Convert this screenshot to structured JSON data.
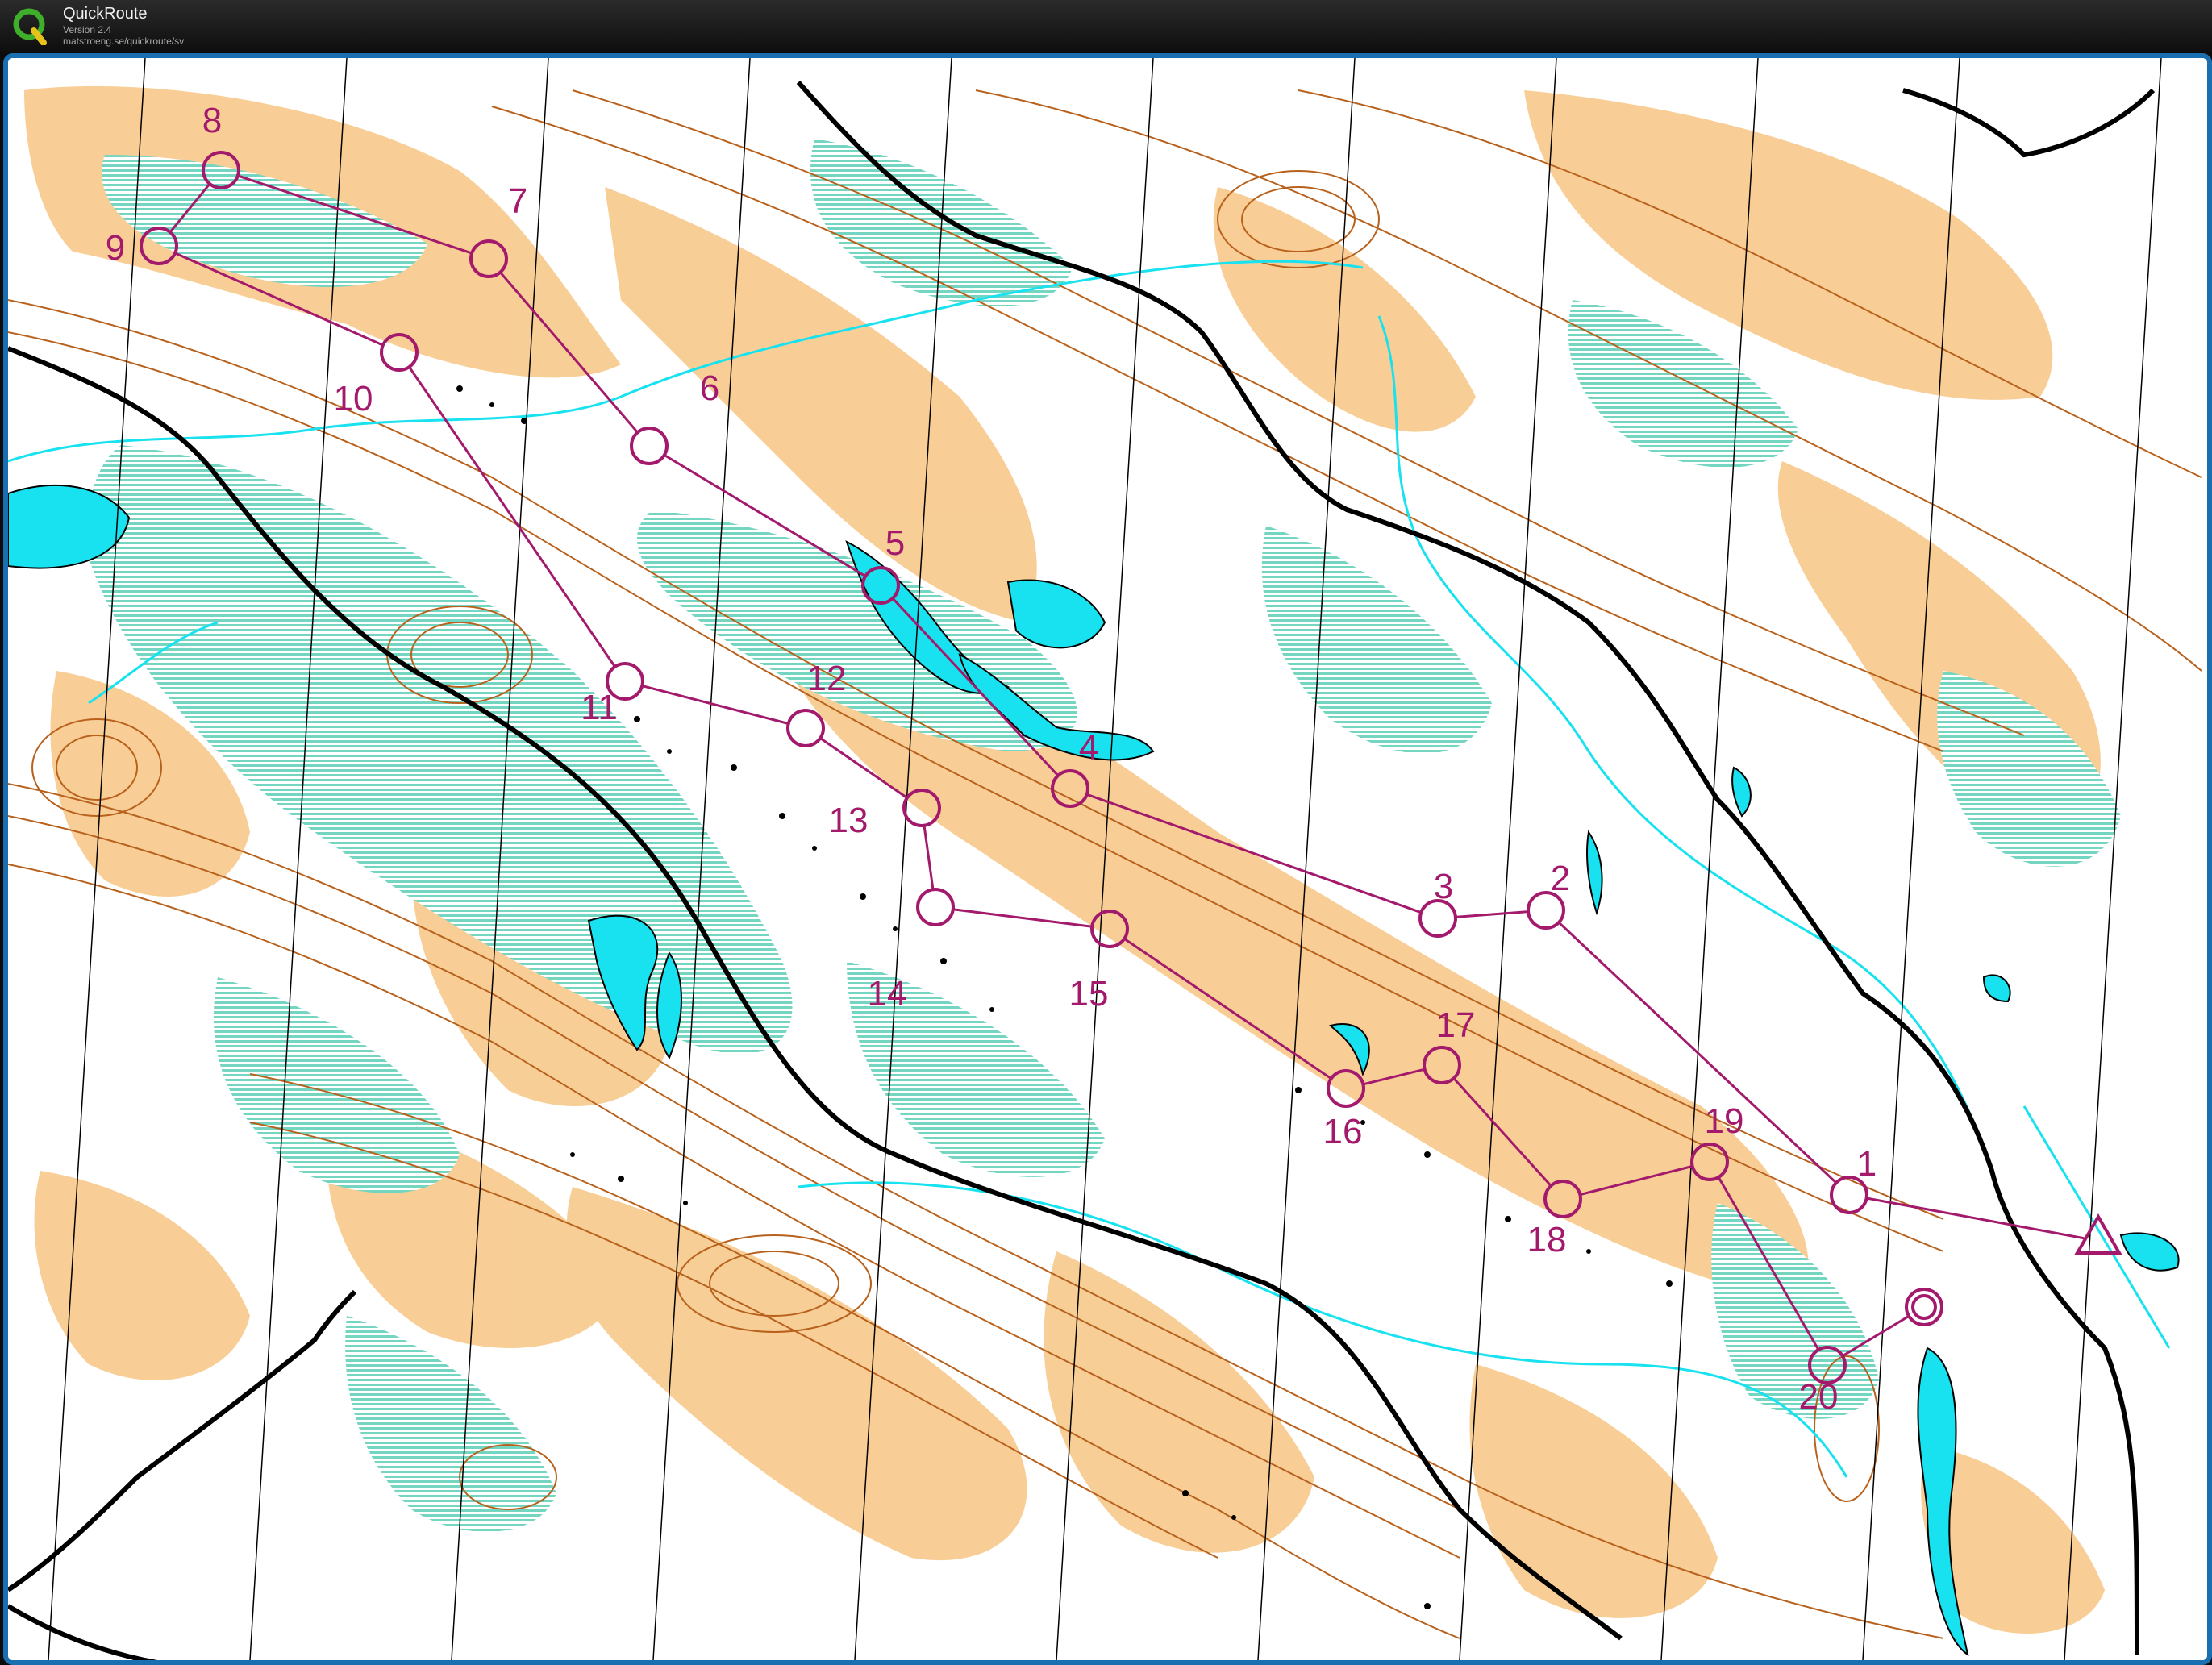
{
  "app": {
    "title": "QuickRoute",
    "version": "Version 2.4",
    "url": "matstroeng.se/quickroute/sv",
    "logo_letter": "Q"
  },
  "colors": {
    "course": "#a3196c",
    "open_land": "#f7c98b",
    "marsh": "#74d6c0",
    "water": "#18e2f0",
    "contour": "#b8611c",
    "road": "#000000",
    "frame": "#1a6fb0"
  },
  "course": {
    "start_icon": "start-triangle-icon",
    "finish_icon": "finish-double-circle-icon",
    "controls": [
      {
        "n": "1"
      },
      {
        "n": "2"
      },
      {
        "n": "3"
      },
      {
        "n": "4"
      },
      {
        "n": "5"
      },
      {
        "n": "6"
      },
      {
        "n": "7"
      },
      {
        "n": "8"
      },
      {
        "n": "9"
      },
      {
        "n": "10"
      },
      {
        "n": "11"
      },
      {
        "n": "12"
      },
      {
        "n": "13"
      },
      {
        "n": "14"
      },
      {
        "n": "15"
      },
      {
        "n": "16"
      },
      {
        "n": "17"
      },
      {
        "n": "18"
      },
      {
        "n": "19"
      },
      {
        "n": "20"
      }
    ]
  }
}
